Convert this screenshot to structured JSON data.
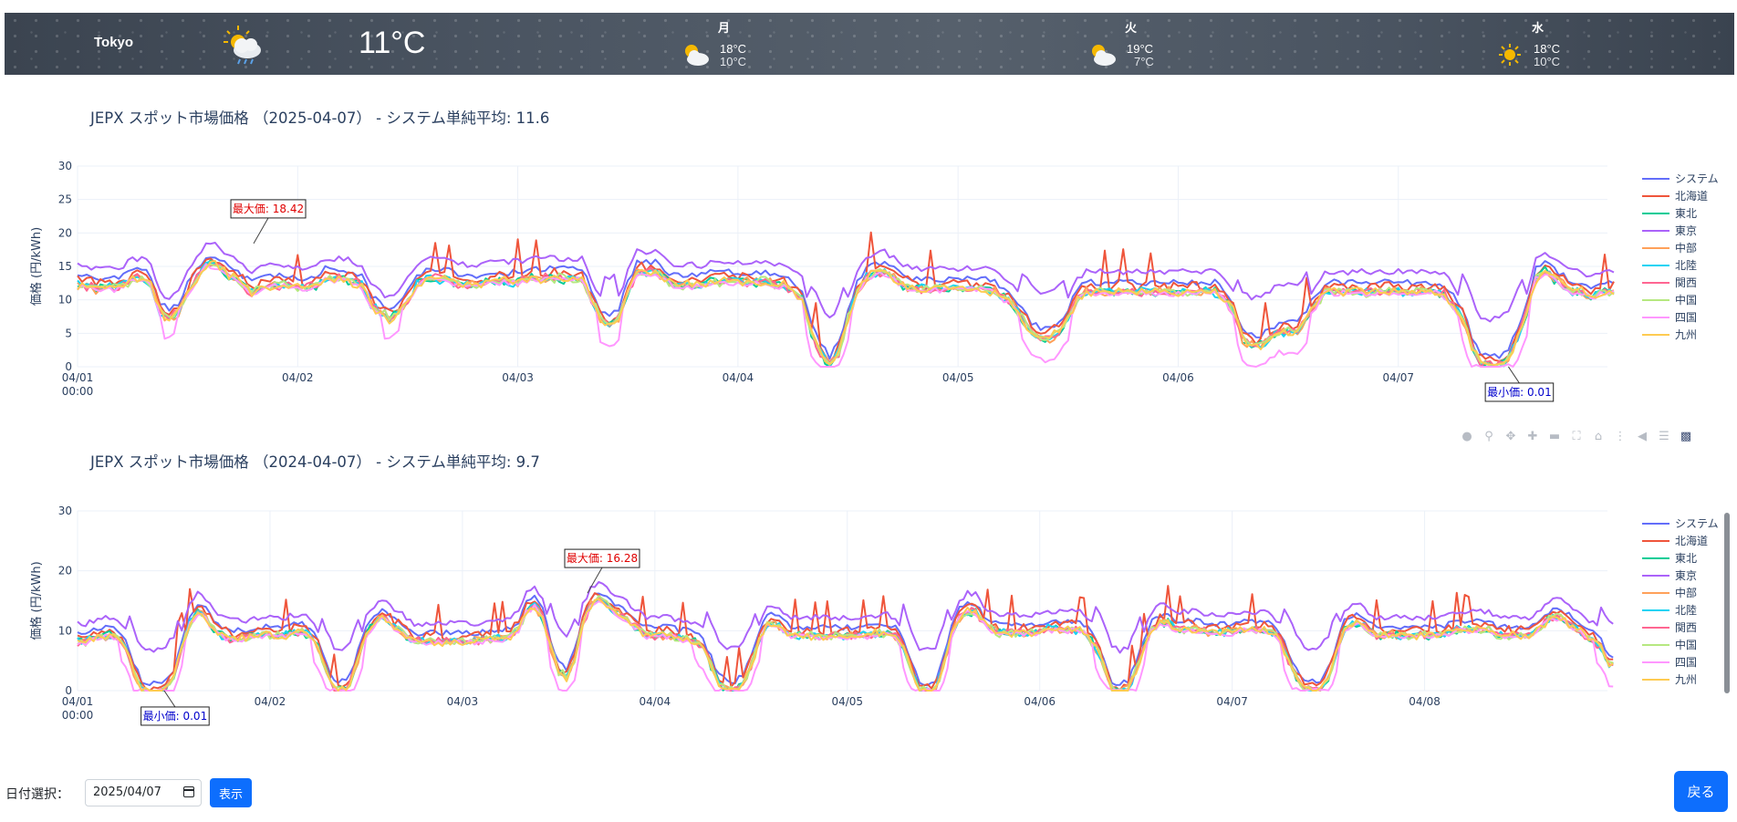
{
  "weather": {
    "city": "Tokyo",
    "current_icon": "cloud-rain-sun-icon",
    "current_temp": "11°C",
    "forecast": [
      {
        "day": "月",
        "icon": "partly-cloudy-icon",
        "high": "18°C",
        "low": "10°C"
      },
      {
        "day": "火",
        "icon": "partly-cloudy-icon",
        "high": "19°C",
        "low": "7°C"
      },
      {
        "day": "水",
        "icon": "sun-icon",
        "high": "18°C",
        "low": "10°C"
      }
    ]
  },
  "chart_data": [
    {
      "type": "line",
      "title": "JEPX スポット市場価格 （2025-04-07） - システム単純平均: 11.6",
      "ylabel": "価格 (円/kWh)",
      "ylim": [
        0,
        30
      ],
      "yticks": [
        0,
        5,
        10,
        15,
        20,
        25,
        30
      ],
      "x_ticks": [
        "04/01\n00:00",
        "04/02",
        "04/03",
        "04/04",
        "04/05",
        "04/06",
        "04/07"
      ],
      "x_range_days": [
        0,
        6.95
      ],
      "legend_placement": "right",
      "annotations": [
        {
          "text": "最大価: 18.42",
          "x_day": 0.8,
          "y": 18.42,
          "color": "#e00000"
        },
        {
          "text": "最小価: 0.01",
          "x_day": 6.5,
          "y": 0.01,
          "color": "#0000cc"
        }
      ],
      "profile_hourly_days": [
        [
          13,
          13,
          12.5,
          12.5,
          12.5,
          13,
          14,
          14,
          13,
          9,
          8,
          9,
          12,
          14,
          16,
          16,
          15,
          14,
          13,
          12,
          12.5,
          13,
          13,
          13
        ],
        [
          12.5,
          12.5,
          13,
          14,
          14,
          14,
          13.5,
          13,
          10,
          9,
          8,
          9,
          11,
          13,
          14,
          14,
          14,
          13.5,
          13,
          13,
          13,
          13.5,
          13.5,
          13.5
        ],
        [
          13.5,
          14,
          14,
          14,
          14,
          14,
          14,
          14,
          11,
          8,
          7,
          8,
          12,
          15,
          15,
          15,
          14,
          13,
          13,
          13,
          13,
          13.5,
          13.5,
          13.5
        ],
        [
          13.5,
          13.5,
          13.5,
          13.5,
          13,
          13,
          12,
          11,
          6,
          3,
          1,
          3,
          8,
          12,
          14,
          15,
          15,
          14,
          13,
          12.5,
          12.5,
          12.5,
          12.5,
          12.5
        ],
        [
          12.5,
          12.5,
          12.5,
          12.5,
          12,
          11,
          10,
          8,
          6,
          5,
          5,
          6,
          8,
          11,
          12,
          12,
          12,
          12,
          12,
          12,
          12,
          12,
          12,
          12
        ],
        [
          12,
          12,
          12,
          12,
          12,
          11,
          9,
          5,
          4,
          4,
          5,
          6,
          6,
          6,
          8,
          10,
          12,
          12,
          12,
          12,
          12,
          12,
          12,
          12
        ],
        [
          12,
          12,
          12,
          12,
          12,
          11.5,
          10,
          8,
          4,
          1,
          1,
          1,
          2,
          5,
          9,
          14,
          15,
          14,
          13,
          12,
          12,
          11,
          12,
          12
        ]
      ],
      "series": [
        {
          "name": "システム",
          "color": "#636efa"
        },
        {
          "name": "北海道",
          "color": "#ef553b"
        },
        {
          "name": "東北",
          "color": "#00cc96"
        },
        {
          "name": "東京",
          "color": "#ab63fa"
        },
        {
          "name": "中部",
          "color": "#ffa15a"
        },
        {
          "name": "北陸",
          "color": "#19d3f3"
        },
        {
          "name": "関西",
          "color": "#ff6692"
        },
        {
          "name": "中国",
          "color": "#b6e880"
        },
        {
          "name": "四国",
          "color": "#ff97ff"
        },
        {
          "name": "九州",
          "color": "#fecb52"
        }
      ]
    },
    {
      "type": "line",
      "title": "JEPX スポット市場価格 （2024-04-07） - システム単純平均: 9.7",
      "ylabel": "価格 (円/kWh)",
      "ylim": [
        0,
        30
      ],
      "yticks": [
        0,
        10,
        20,
        30
      ],
      "x_ticks": [
        "04/01\n00:00",
        "04/02",
        "04/03",
        "04/04",
        "04/05",
        "04/06",
        "04/07",
        "04/08"
      ],
      "x_range_days": [
        0,
        7.95
      ],
      "legend_placement": "right",
      "annotations": [
        {
          "text": "最大価: 16.28",
          "x_day": 2.65,
          "y": 16.28,
          "color": "#e00000"
        },
        {
          "text": "最小価: 0.01",
          "x_day": 0.45,
          "y": 0.01,
          "color": "#0000cc"
        }
      ],
      "profile_hourly_days": [
        [
          9,
          9,
          9.5,
          10,
          10,
          9.5,
          8,
          4,
          1,
          0.5,
          0.5,
          1,
          3,
          8,
          12,
          14,
          13,
          11,
          10,
          9.5,
          9.5,
          9.5,
          10,
          10
        ],
        [
          10,
          10,
          10,
          10.5,
          10.5,
          10,
          8,
          4,
          1,
          1,
          2,
          6,
          10,
          12,
          13,
          12,
          11,
          10,
          9,
          9,
          9,
          9,
          9,
          9
        ],
        [
          9,
          9,
          9,
          9.5,
          9.5,
          9.5,
          10,
          11,
          14,
          15,
          13,
          8,
          4,
          3,
          6,
          12,
          15,
          16,
          15,
          14,
          13,
          12,
          11,
          10
        ],
        [
          10,
          10,
          10,
          9.5,
          9.5,
          9,
          8,
          5,
          2,
          1,
          1,
          2,
          5,
          9,
          12,
          12,
          11,
          10,
          10,
          10,
          10,
          10,
          10,
          10
        ],
        [
          10,
          10,
          10,
          10,
          10.5,
          10.5,
          10,
          8,
          4,
          1,
          0.5,
          1,
          5,
          10,
          13,
          14,
          14,
          12,
          11,
          10.5,
          10.5,
          10.5,
          10.5,
          10.5
        ],
        [
          10.5,
          11,
          11,
          11,
          11,
          11,
          10,
          8,
          5,
          1,
          0.5,
          1,
          4,
          8,
          11,
          12,
          12,
          11,
          11,
          11,
          11,
          10.5,
          10.5,
          10.5
        ],
        [
          10.5,
          11,
          11,
          11,
          11,
          10.5,
          9,
          6,
          3,
          1,
          1,
          1,
          3,
          7,
          11,
          12,
          12,
          11,
          10,
          10,
          10,
          10,
          10,
          10
        ],
        [
          10,
          10,
          10,
          10.5,
          11,
          11,
          11,
          11,
          11,
          10,
          10,
          10,
          10,
          10,
          11,
          12,
          13,
          13,
          12,
          11,
          10,
          9,
          8,
          5
        ]
      ],
      "series": [
        {
          "name": "システム",
          "color": "#636efa"
        },
        {
          "name": "北海道",
          "color": "#ef553b"
        },
        {
          "name": "東北",
          "color": "#00cc96"
        },
        {
          "name": "東京",
          "color": "#ab63fa"
        },
        {
          "name": "中部",
          "color": "#ffa15a"
        },
        {
          "name": "北陸",
          "color": "#19d3f3"
        },
        {
          "name": "関西",
          "color": "#ff6692"
        },
        {
          "name": "中国",
          "color": "#b6e880"
        },
        {
          "name": "四国",
          "color": "#ff97ff"
        },
        {
          "name": "九州",
          "color": "#fecb52"
        }
      ]
    }
  ],
  "controls": {
    "date_label": "日付選択：",
    "date_value": "2025/04/07",
    "show_button": "表示",
    "back_button": "戻る"
  },
  "modebar_icons": [
    "camera-icon",
    "zoom-icon",
    "pan-icon",
    "zoom-in-icon",
    "zoom-out-icon",
    "autoscale-icon",
    "home-icon",
    "spike-icon",
    "hover-closest-icon",
    "hover-compare-icon",
    "plotly-logo-icon"
  ]
}
